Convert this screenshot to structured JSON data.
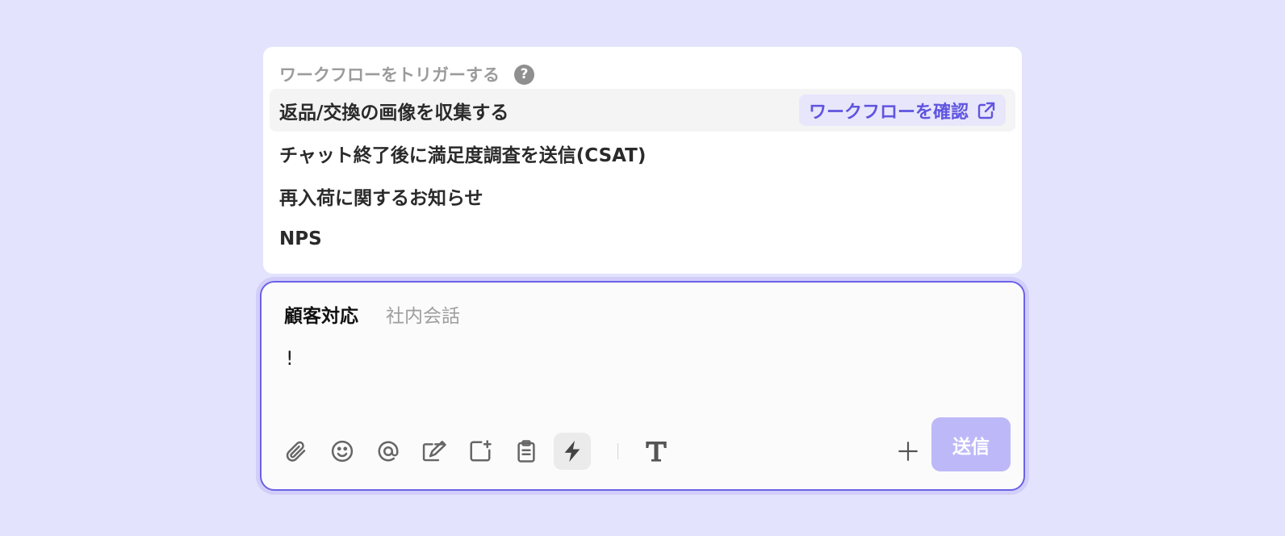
{
  "workflow_menu": {
    "title": "ワークフローをトリガーする",
    "help_glyph": "?",
    "items": [
      {
        "label": "返品/交換の画像を収集する"
      },
      {
        "label": "チャット終了後に満足度調査を送信(CSAT)"
      },
      {
        "label": "再入荷に関するお知らせ"
      },
      {
        "label": "NPS"
      }
    ],
    "view_workflow_label": "ワークフローを確認"
  },
  "composer": {
    "tabs": [
      "顧客対応",
      "社内会話"
    ],
    "active_tab": "顧客対応",
    "draft_text": "!",
    "toolbar_icons": [
      "paperclip-icon",
      "emoji-icon",
      "mention-icon",
      "edit-icon",
      "add-note-icon",
      "clipboard-icon",
      "lightning-icon",
      "text-format-icon"
    ],
    "send_label": "送信"
  },
  "colors": {
    "background": "#e4e3fd",
    "accent": "#5f55e0",
    "send_disabled": "#bdb9f8"
  }
}
